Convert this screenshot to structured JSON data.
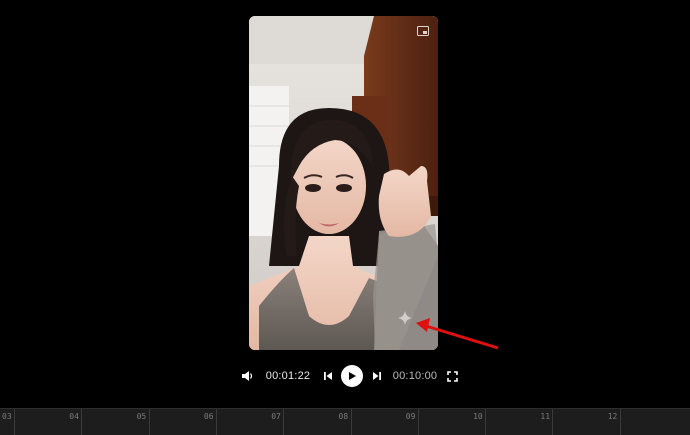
{
  "player": {
    "current_time": "00:01:22",
    "total_time": "00:10:00",
    "colors": {
      "background": "#000000",
      "control_fg": "#ffffff",
      "annotation_arrow": "#e01010"
    }
  },
  "icons": {
    "volume": "volume-icon",
    "skip_back": "skip-back-icon",
    "play": "play-icon",
    "skip_forward": "skip-forward-icon",
    "fullscreen": "fullscreen-icon",
    "pip": "picture-in-picture-icon",
    "sparkle": "sparkle-watermark-icon"
  },
  "timeline": {
    "ticks": [
      "03",
      "04",
      "05",
      "06",
      "07",
      "08",
      "09",
      "10",
      "11",
      "12"
    ]
  }
}
